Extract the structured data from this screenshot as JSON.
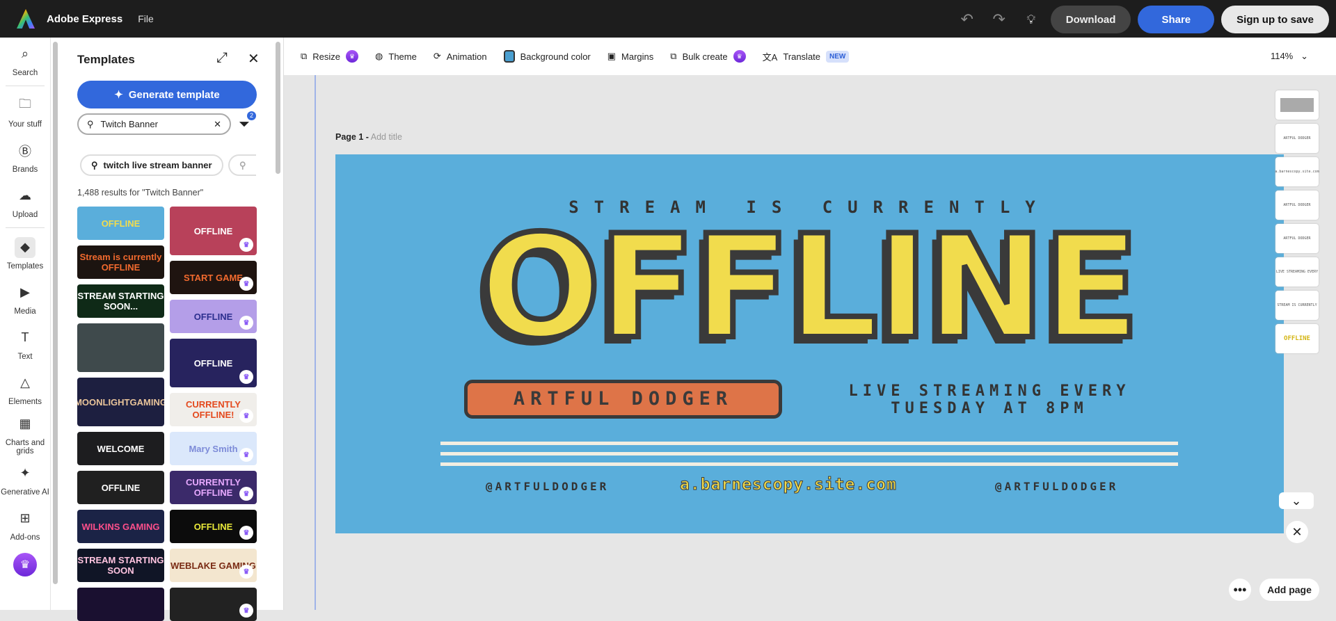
{
  "app": {
    "title": "Adobe Express",
    "file_menu": "File"
  },
  "header": {
    "download": "Download",
    "share": "Share",
    "signup": "Sign up to save"
  },
  "rail": [
    {
      "label": "Search",
      "icon": "⌕"
    },
    {
      "label": "Your stuff",
      "icon": "🗀"
    },
    {
      "label": "Brands",
      "icon": "Ⓑ"
    },
    {
      "label": "Upload",
      "icon": "☁"
    },
    {
      "label": "Templates",
      "icon": "◆"
    },
    {
      "label": "Media",
      "icon": "▶"
    },
    {
      "label": "Text",
      "icon": "T"
    },
    {
      "label": "Elements",
      "icon": "△"
    },
    {
      "label": "Charts and grids",
      "icon": "▦"
    },
    {
      "label": "Generative AI",
      "icon": "✦"
    },
    {
      "label": "Add-ons",
      "icon": "⊞"
    }
  ],
  "panel": {
    "title": "Templates",
    "generate": "Generate template",
    "search_value": "Twitch Banner",
    "filter_count": "2",
    "chip": "twitch live stream banner",
    "results": "1,488 results for \"Twitch Banner\""
  },
  "templates": {
    "col1": [
      {
        "t": "OFFLINE",
        "bg": "#5aaedb",
        "c": "#f1dc4d",
        "h": 48
      },
      {
        "t": "Stream is currently OFFLINE",
        "bg": "#1c1410",
        "c": "#f26a2e",
        "h": 48
      },
      {
        "t": "STREAM STARTING SOON...",
        "bg": "#0f2a17",
        "c": "#fff",
        "h": 48
      },
      {
        "t": "",
        "bg": "#3f4a4c",
        "c": "#fff",
        "h": 70
      },
      {
        "t": "MOONLIGHTGAMING",
        "bg": "#1d1f40",
        "c": "#e9c49a",
        "h": 70
      },
      {
        "t": "WELCOME",
        "bg": "#1d1d1f",
        "c": "#fff",
        "h": 48
      },
      {
        "t": "OFFLINE",
        "bg": "#202020",
        "c": "#fff",
        "h": 48
      },
      {
        "t": "WILKINS GAMING",
        "bg": "#1b2346",
        "c": "#ff4f8b",
        "h": 48
      },
      {
        "t": "STREAM STARTING SOON",
        "bg": "#101526",
        "c": "#ffc4e0",
        "h": 48
      },
      {
        "t": "",
        "bg": "#1a1030",
        "c": "#fff",
        "h": 48
      }
    ],
    "col2": [
      {
        "t": "OFFLINE",
        "bg": "#b8415a",
        "c": "#fff",
        "h": 70
      },
      {
        "t": "START GAME",
        "bg": "#1f1410",
        "c": "#f26a2e",
        "h": 48
      },
      {
        "t": "OFFLINE",
        "bg": "#b49ee8",
        "c": "#2c2f8e",
        "h": 48
      },
      {
        "t": "OFFLINE",
        "bg": "#27235e",
        "c": "#fff",
        "h": 70
      },
      {
        "t": "CURRENTLY OFFLINE!",
        "bg": "#f0eeea",
        "c": "#e4491d",
        "h": 48
      },
      {
        "t": "Mary Smith",
        "bg": "#dbe8fb",
        "c": "#7d8bd8",
        "h": 48
      },
      {
        "t": "CURRENTLY OFFLINE",
        "bg": "#3b2a6a",
        "c": "#e7a9ff",
        "h": 48
      },
      {
        "t": "OFFLINE",
        "bg": "#0c0c0c",
        "c": "#eaea3a",
        "h": 48
      },
      {
        "t": "WEBLAKE GAMING",
        "bg": "#f3e6cf",
        "c": "#7a2b14",
        "h": 48
      },
      {
        "t": "",
        "bg": "#222",
        "c": "#fff",
        "h": 48
      }
    ]
  },
  "toolbar": {
    "resize": "Resize",
    "theme": "Theme",
    "animation": "Animation",
    "background": "Background color",
    "margins": "Margins",
    "bulk": "Bulk create",
    "translate": "Translate",
    "new_badge": "NEW",
    "zoom": "114%"
  },
  "page": {
    "label": "Page 1 -",
    "placeholder": "Add title"
  },
  "banner": {
    "top": "STREAM IS CURRENTLY",
    "headline": "OFFLINE",
    "name": "ARTFUL DODGER",
    "schedule1": "LIVE STREAMING EVERY",
    "schedule2": "TUESDAY AT 8PM",
    "handle_left": "@ARTFULDODGER",
    "url": "a.barnescopy.site.com",
    "handle_right": "@ARTFULDODGER"
  },
  "thumbs": [
    "",
    "ARTFUL DODGER",
    "a.barnescopy.site.com",
    "ARTFUL DODGER",
    "ARTFUL DODGER",
    "LIVE STREAMING EVERY",
    "STREAM IS CURRENTLY",
    "OFFLINE"
  ],
  "footer": {
    "add_page": "Add page"
  }
}
